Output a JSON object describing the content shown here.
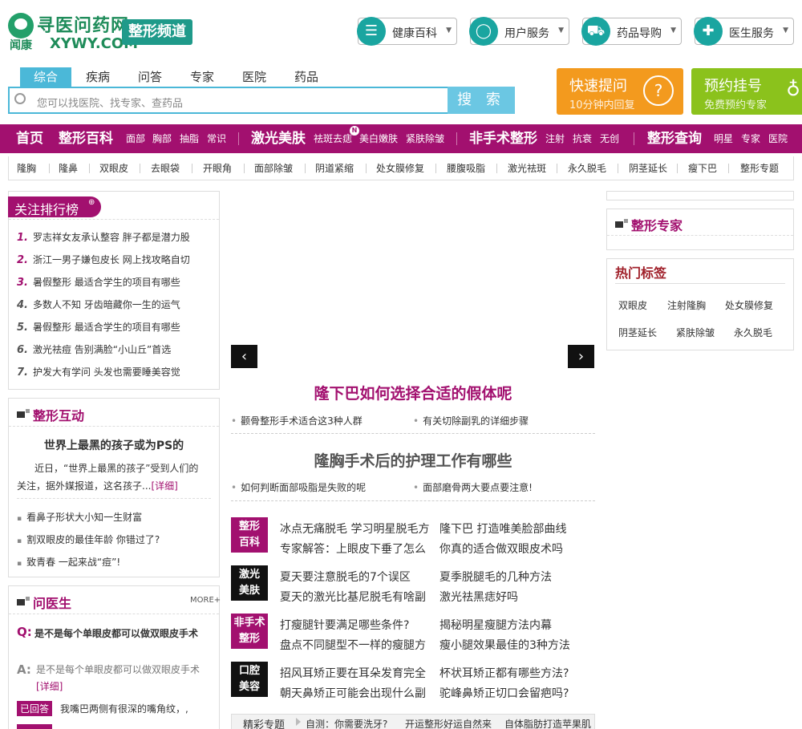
{
  "header": {
    "logo_cn": "寻医问药网",
    "logo_sub": "闻康",
    "logo_en": "XYWY.COM",
    "channel": "整形频道",
    "services": [
      "健康百科",
      "用户服务",
      "药品导购",
      "医生服务"
    ]
  },
  "search": {
    "tabs": [
      "综合",
      "疾病",
      "问答",
      "专家",
      "医院",
      "药品"
    ],
    "placeholder": "您可以找医院、找专家、查药品",
    "button": "搜 索"
  },
  "quick_ask": {
    "title": "快速提问",
    "sub": "10分钟内回复"
  },
  "appointment": {
    "title": "预约挂号",
    "sub": "免费预约专家"
  },
  "nav": {
    "home": "首页",
    "g1": {
      "title": "整形百科",
      "items": [
        "面部",
        "胸部",
        "抽脂",
        "常识"
      ]
    },
    "g2": {
      "title": "激光美肤",
      "items": [
        "祛斑去痣",
        "美白嫩肤",
        "紧肤除皱"
      ],
      "badge": "N"
    },
    "g3": {
      "title": "非手术整形",
      "items": [
        "注射",
        "抗衰",
        "无创"
      ]
    },
    "g4": {
      "title": "整形查询",
      "items": [
        "明星",
        "专家",
        "医院"
      ]
    }
  },
  "subnav": [
    "隆胸",
    "隆鼻",
    "双眼皮",
    "去眼袋",
    "开眼角",
    "面部除皱",
    "阴道紧缩",
    "处女膜修复",
    "腰腹吸脂",
    "激光祛斑",
    "永久脱毛",
    "阴茎延长",
    "瘦下巴",
    "整形专题"
  ],
  "ranking": {
    "title": "关注排行榜",
    "items": [
      "罗志祥女友承认整容 胖子都是潜力股",
      "浙江一男子嫌包皮长 网上找攻略自切",
      "暑假整形 最适合学生的项目有哪些",
      "多数人不知 牙齿暗藏你一生的运气",
      "暑假整形 最适合学生的项目有哪些",
      "激光祛痘 告别满脸“小山丘”首选",
      "护发大有学问 头发也需要睡美容觉"
    ]
  },
  "interact": {
    "title": "整形互动",
    "headline": "世界上最黑的孩子或为PS的",
    "summary_1": "近日，“世界上最黑的孩子”受到人们的",
    "summary_2": "关注，据外媒报道，这名孩子...",
    "detail": "[详细]",
    "links": [
      "看鼻子形状大小知一生财富",
      "割双眼皮的最佳年龄 你错过了?",
      "致青春 一起来战“痘”!"
    ]
  },
  "ask_doctor": {
    "title": "问医生",
    "more": "MORE+",
    "q_mark": "Q:",
    "a_mark": "A:",
    "question": "是不是每个单眼皮都可以做双眼皮手术",
    "answer": "是不是每个单眼皮都可以做双眼皮手术",
    "detail": "[详细]",
    "answered": "已回答",
    "answered_q": "我嘴巴两侧有很深的嘴角纹，,"
  },
  "slider": {
    "prev": "‹",
    "next": "›"
  },
  "headline1": {
    "title": "隆下巴如何选择合适的假体呢",
    "subs": [
      "颧骨整形手术适合这3种人群",
      "有关切除副乳的详细步骤"
    ]
  },
  "headline2": {
    "title": "隆胸手术后的护理工作有哪些",
    "subs": [
      "如何判断面部吸脂是失败的呢",
      "面部磨骨两大要点要注意!"
    ]
  },
  "categories": [
    {
      "l1": "整形",
      "l2": "百科",
      "links": [
        "冰点无痛脱毛 学习明星脱毛方",
        "专家解答：上眼皮下垂了怎么",
        "隆下巴 打造唯美脸部曲线",
        "你真的适合做双眼皮术吗"
      ]
    },
    {
      "l1": "激光",
      "l2": "美肤",
      "links": [
        "夏天要注意脱毛的7个误区",
        "夏天的激光比基尼脱毛有啥副",
        "夏季脱腿毛的几种方法",
        "激光祛黑痣好吗"
      ]
    },
    {
      "l1": "非手术",
      "l2": "整形",
      "links": [
        "打瘦腿针要满足哪些条件?",
        "盘点不同腿型不一样的瘦腿方",
        "揭秘明星瘦腿方法内幕",
        "瘦小腿效果最佳的3种方法"
      ]
    },
    {
      "l1": "口腔",
      "l2": "美容",
      "links": [
        "招风耳矫正要在耳朵发育完全",
        "朝天鼻矫正可能会出现什么副",
        "杯状耳矫正都有哪些方法?",
        "驼峰鼻矫正切口会留疤吗?"
      ]
    }
  ],
  "topics": {
    "label": "精彩专题",
    "items": [
      "自测：你需要洗牙?",
      "开运整形好运自然来",
      "自体脂肪打造苹果肌"
    ]
  },
  "experts": {
    "title": "整形专家"
  },
  "tags": {
    "title": "热门标签",
    "items": [
      "双眼皮",
      "注射隆胸",
      "处女膜修复",
      "阴茎延长",
      "紧肤除皱",
      "永久脱毛"
    ]
  },
  "colors": {
    "brand": "#a2106f",
    "accent": "#4bb8d8",
    "orange": "#f39a1e",
    "green": "#8bc21c"
  }
}
